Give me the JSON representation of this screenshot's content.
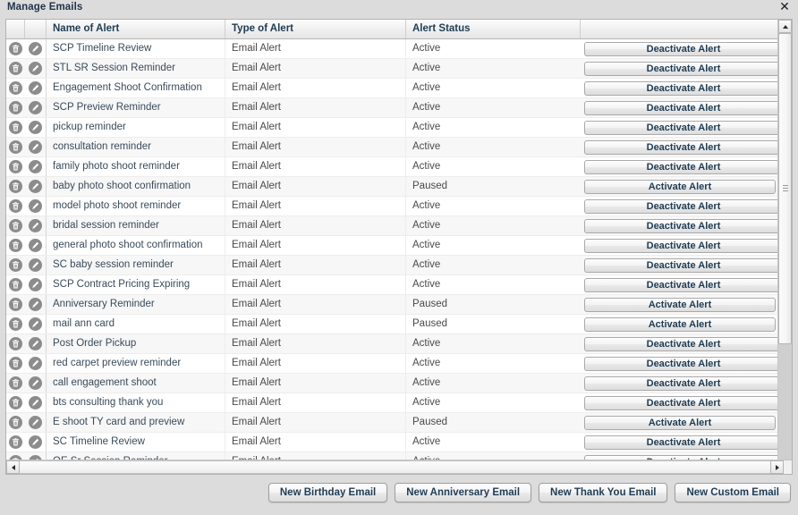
{
  "window": {
    "title": "Manage Emails",
    "close_label": "✕"
  },
  "table": {
    "columns": [
      {
        "key": "delete",
        "label": ""
      },
      {
        "key": "edit",
        "label": ""
      },
      {
        "key": "name",
        "label": "Name of Alert"
      },
      {
        "key": "type",
        "label": "Type of Alert"
      },
      {
        "key": "status",
        "label": "Alert Status"
      },
      {
        "key": "action",
        "label": ""
      }
    ],
    "action_labels": {
      "active": "Deactivate Alert",
      "paused": "Activate Alert"
    },
    "row_icons": {
      "delete": "trash-icon",
      "edit": "pencil-icon"
    },
    "rows": [
      {
        "name": "SCP Timeline Review",
        "type": "Email Alert",
        "status": "Active",
        "action": "Deactivate Alert"
      },
      {
        "name": "STL SR Session Reminder",
        "type": "Email Alert",
        "status": "Active",
        "action": "Deactivate Alert"
      },
      {
        "name": "Engagement Shoot Confirmation",
        "type": "Email Alert",
        "status": "Active",
        "action": "Deactivate Alert"
      },
      {
        "name": "SCP Preview Reminder",
        "type": "Email Alert",
        "status": "Active",
        "action": "Deactivate Alert"
      },
      {
        "name": "pickup reminder",
        "type": "Email Alert",
        "status": "Active",
        "action": "Deactivate Alert"
      },
      {
        "name": "consultation reminder",
        "type": "Email Alert",
        "status": "Active",
        "action": "Deactivate Alert"
      },
      {
        "name": "family photo shoot reminder",
        "type": "Email Alert",
        "status": "Active",
        "action": "Deactivate Alert"
      },
      {
        "name": "baby photo shoot confirmation",
        "type": "Email Alert",
        "status": "Paused",
        "action": "Activate Alert"
      },
      {
        "name": "model photo shoot reminder",
        "type": "Email Alert",
        "status": "Active",
        "action": "Deactivate Alert"
      },
      {
        "name": "bridal session reminder",
        "type": "Email Alert",
        "status": "Active",
        "action": "Deactivate Alert"
      },
      {
        "name": "general photo shoot confirmation",
        "type": "Email Alert",
        "status": "Active",
        "action": "Deactivate Alert"
      },
      {
        "name": "SC baby session reminder",
        "type": "Email Alert",
        "status": "Active",
        "action": "Deactivate Alert"
      },
      {
        "name": "SCP Contract Pricing Expiring",
        "type": "Email Alert",
        "status": "Active",
        "action": "Deactivate Alert"
      },
      {
        "name": "Anniversary Reminder",
        "type": "Email Alert",
        "status": "Paused",
        "action": "Activate Alert"
      },
      {
        "name": "mail ann card",
        "type": "Email Alert",
        "status": "Paused",
        "action": "Activate Alert"
      },
      {
        "name": "Post Order Pickup",
        "type": "Email Alert",
        "status": "Active",
        "action": "Deactivate Alert"
      },
      {
        "name": "red carpet preview reminder",
        "type": "Email Alert",
        "status": "Active",
        "action": "Deactivate Alert"
      },
      {
        "name": "call engagement shoot",
        "type": "Email Alert",
        "status": "Active",
        "action": "Deactivate Alert"
      },
      {
        "name": "bts consulting thank you",
        "type": "Email Alert",
        "status": "Active",
        "action": "Deactivate Alert"
      },
      {
        "name": "E shoot TY card and preview",
        "type": "Email Alert",
        "status": "Paused",
        "action": "Activate Alert"
      },
      {
        "name": "SC Timeline Review",
        "type": "Email Alert",
        "status": "Active",
        "action": "Deactivate Alert"
      },
      {
        "name": "QE Sr Session Reminder",
        "type": "Email Alert",
        "status": "Active",
        "action": "Deactivate Alert"
      }
    ]
  },
  "scrollbars": {
    "vertical": {
      "up_arrow": "▲",
      "down_arrow": "▼"
    },
    "horizontal": {
      "left_arrow": "◀",
      "right_arrow": "▶"
    }
  },
  "footer": {
    "buttons": [
      "New Birthday Email",
      "New Anniversary Email",
      "New Thank You Email",
      "New Custom Email"
    ]
  },
  "colors": {
    "page_background": "#dcdcdc",
    "grid_background": "#ffffff",
    "row_alt_background": "#f7f7f7",
    "header_text": "#1f3c54",
    "body_text": "#4a4a4a",
    "icon_circle": "#8c8c8c"
  }
}
